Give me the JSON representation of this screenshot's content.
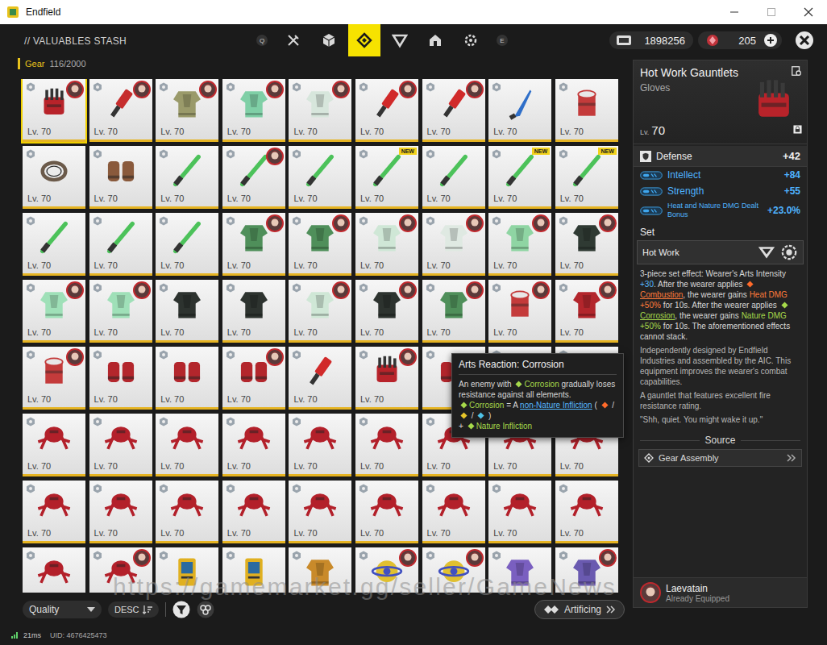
{
  "window": {
    "title": "Endfield"
  },
  "header": {
    "title": "// VALUABLES STASH",
    "key_prev": "Q",
    "key_next": "E",
    "tabs": [
      {
        "kind": "edit",
        "selected": false
      },
      {
        "kind": "cube",
        "selected": false
      },
      {
        "kind": "diamond",
        "selected": true
      },
      {
        "kind": "triangle",
        "selected": false
      },
      {
        "kind": "house",
        "selected": false
      },
      {
        "kind": "gear",
        "selected": false
      }
    ],
    "currencies": [
      {
        "kind": "coin",
        "value": "1898256",
        "plus": false
      },
      {
        "kind": "gem",
        "value": "205",
        "plus": true
      }
    ]
  },
  "category": {
    "label": "Gear",
    "count": "116/2000"
  },
  "cards": [
    {
      "kind": "gauntlet",
      "color": "#b8232a",
      "level": "Lv. 70",
      "equipped": true,
      "badge": "",
      "selected": true
    },
    {
      "kind": "tool",
      "color": "#c62d2d",
      "level": "Lv. 70",
      "equipped": true,
      "badge": "",
      "selected": false
    },
    {
      "kind": "armor",
      "color": "#9a9a6a",
      "level": "Lv. 70",
      "equipped": true,
      "badge": "",
      "selected": false
    },
    {
      "kind": "armor",
      "color": "#7fcfa6",
      "level": "Lv. 70",
      "equipped": true,
      "badge": "",
      "selected": false
    },
    {
      "kind": "armor",
      "color": "#d7e6dc",
      "level": "Lv. 70",
      "equipped": true,
      "badge": "",
      "selected": false
    },
    {
      "kind": "tool",
      "color": "#d12a2a",
      "level": "Lv. 70",
      "equipped": true,
      "badge": "",
      "selected": false
    },
    {
      "kind": "tool",
      "color": "#d12a2a",
      "level": "Lv. 70",
      "equipped": true,
      "badge": "",
      "selected": false
    },
    {
      "kind": "knife",
      "color": "#2f6fc9",
      "level": "Lv. 70",
      "equipped": false,
      "badge": "",
      "selected": false
    },
    {
      "kind": "drum",
      "color": "#c43b3b",
      "level": "Lv. 70",
      "equipped": false,
      "badge": "",
      "selected": false
    },
    {
      "kind": "ring",
      "color": "#6b5a4a",
      "level": "Lv. 70",
      "equipped": false,
      "badge": "",
      "selected": false
    },
    {
      "kind": "gloves",
      "color": "#8a5a3c",
      "level": "Lv. 70",
      "equipped": false,
      "badge": "",
      "selected": false
    },
    {
      "kind": "rod",
      "color": "#4cc25a",
      "level": "Lv. 70",
      "equipped": false,
      "badge": "",
      "selected": false
    },
    {
      "kind": "rod",
      "color": "#4cc25a",
      "level": "Lv. 70",
      "equipped": true,
      "badge": "",
      "selected": false
    },
    {
      "kind": "rod",
      "color": "#4cc25a",
      "level": "Lv. 70",
      "equipped": false,
      "badge": "",
      "selected": false
    },
    {
      "kind": "rod",
      "color": "#4cc25a",
      "level": "Lv. 70",
      "equipped": false,
      "badge": "NEW",
      "selected": false
    },
    {
      "kind": "rod",
      "color": "#4cc25a",
      "level": "Lv. 70",
      "equipped": false,
      "badge": "",
      "selected": false
    },
    {
      "kind": "rod",
      "color": "#4cc25a",
      "level": "Lv. 70",
      "equipped": false,
      "badge": "NEW",
      "selected": false
    },
    {
      "kind": "rod",
      "color": "#4cc25a",
      "level": "Lv. 70",
      "equipped": false,
      "badge": "NEW",
      "selected": false
    },
    {
      "kind": "rod",
      "color": "#4cc25a",
      "level": "Lv. 70",
      "equipped": false,
      "badge": "",
      "selected": false
    },
    {
      "kind": "rod",
      "color": "#4cc25a",
      "level": "Lv. 70",
      "equipped": false,
      "badge": "",
      "selected": false
    },
    {
      "kind": "rod",
      "color": "#4cc25a",
      "level": "Lv. 70",
      "equipped": false,
      "badge": "",
      "selected": false
    },
    {
      "kind": "armor",
      "color": "#4f8f5a",
      "level": "Lv. 70",
      "equipped": true,
      "badge": "",
      "selected": false
    },
    {
      "kind": "armor",
      "color": "#4f8f5a",
      "level": "Lv. 70",
      "equipped": true,
      "badge": "",
      "selected": false
    },
    {
      "kind": "armor",
      "color": "#cfe7d6",
      "level": "Lv. 70",
      "equipped": true,
      "badge": "",
      "selected": false
    },
    {
      "kind": "armor",
      "color": "#dfe9e2",
      "level": "Lv. 70",
      "equipped": true,
      "badge": "",
      "selected": false
    },
    {
      "kind": "armor",
      "color": "#8fd5a3",
      "level": "Lv. 70",
      "equipped": true,
      "badge": "",
      "selected": false
    },
    {
      "kind": "armor",
      "color": "#2f3a33",
      "level": "Lv. 70",
      "equipped": true,
      "badge": "",
      "selected": false
    },
    {
      "kind": "armor",
      "color": "#9fe0b8",
      "level": "Lv. 70",
      "equipped": true,
      "badge": "",
      "selected": false
    },
    {
      "kind": "armor",
      "color": "#9fe0b8",
      "level": "Lv. 70",
      "equipped": true,
      "badge": "",
      "selected": false
    },
    {
      "kind": "armor",
      "color": "#2d332f",
      "level": "Lv. 70",
      "equipped": false,
      "badge": "",
      "selected": false
    },
    {
      "kind": "armor",
      "color": "#2d332f",
      "level": "Lv. 70",
      "equipped": false,
      "badge": "",
      "selected": false
    },
    {
      "kind": "armor",
      "color": "#cfe7d6",
      "level": "Lv. 70",
      "equipped": true,
      "badge": "",
      "selected": false
    },
    {
      "kind": "armor",
      "color": "#2d332f",
      "level": "Lv. 70",
      "equipped": true,
      "badge": "",
      "selected": false
    },
    {
      "kind": "armor",
      "color": "#4f8f5a",
      "level": "Lv. 70",
      "equipped": true,
      "badge": "",
      "selected": false
    },
    {
      "kind": "drum",
      "color": "#c43b3b",
      "level": "Lv. 70",
      "equipped": true,
      "badge": "",
      "selected": false
    },
    {
      "kind": "armor",
      "color": "#b3262c",
      "level": "Lv. 70",
      "equipped": true,
      "badge": "",
      "selected": false
    },
    {
      "kind": "drum",
      "color": "#c43b3b",
      "level": "Lv. 70",
      "equipped": true,
      "badge": "",
      "selected": false
    },
    {
      "kind": "gloves",
      "color": "#b3262c",
      "level": "Lv. 70",
      "equipped": false,
      "badge": "",
      "selected": false
    },
    {
      "kind": "gloves",
      "color": "#b3262c",
      "level": "Lv. 70",
      "equipped": false,
      "badge": "",
      "selected": false
    },
    {
      "kind": "gloves",
      "color": "#b3262c",
      "level": "Lv. 70",
      "equipped": true,
      "badge": "",
      "selected": false
    },
    {
      "kind": "tool",
      "color": "#d12a2a",
      "level": "Lv. 70",
      "equipped": false,
      "badge": "",
      "selected": false
    },
    {
      "kind": "gauntlet",
      "color": "#b8232a",
      "level": "Lv. 70",
      "equipped": true,
      "badge": "",
      "selected": false
    },
    {
      "kind": "gloves",
      "color": "#b3262c",
      "level": "",
      "equipped": false,
      "badge": "",
      "selected": false
    },
    {
      "kind": "gloves",
      "color": "#b3262c",
      "level": "",
      "equipped": false,
      "badge": "",
      "selected": false
    },
    {
      "kind": "gloves",
      "color": "#b3262c",
      "level": "",
      "equipped": false,
      "badge": "",
      "selected": false
    },
    {
      "kind": "spider",
      "color": "#b3202a",
      "level": "Lv. 70",
      "equipped": false,
      "badge": "",
      "selected": false
    },
    {
      "kind": "spider",
      "color": "#b3202a",
      "level": "Lv. 70",
      "equipped": false,
      "badge": "",
      "selected": false
    },
    {
      "kind": "spider",
      "color": "#b3202a",
      "level": "Lv. 70",
      "equipped": false,
      "badge": "",
      "selected": false
    },
    {
      "kind": "spider",
      "color": "#b3202a",
      "level": "Lv. 70",
      "equipped": false,
      "badge": "",
      "selected": false
    },
    {
      "kind": "spider",
      "color": "#b3202a",
      "level": "Lv. 70",
      "equipped": false,
      "badge": "",
      "selected": false
    },
    {
      "kind": "spider",
      "color": "#b3202a",
      "level": "Lv. 70",
      "equipped": false,
      "badge": "",
      "selected": false
    },
    {
      "kind": "spider",
      "color": "#b3202a",
      "level": "Lv. 70",
      "equipped": false,
      "badge": "",
      "selected": false
    },
    {
      "kind": "spider",
      "color": "#b3202a",
      "level": "Lv. 70",
      "equipped": false,
      "badge": "",
      "selected": false
    },
    {
      "kind": "spider",
      "color": "#b3202a",
      "level": "Lv. 70",
      "equipped": false,
      "badge": "",
      "selected": false
    },
    {
      "kind": "spider",
      "color": "#b3202a",
      "level": "Lv. 70",
      "equipped": false,
      "badge": "",
      "selected": false
    },
    {
      "kind": "spider",
      "color": "#b3202a",
      "level": "Lv. 70",
      "equipped": false,
      "badge": "",
      "selected": false
    },
    {
      "kind": "spider",
      "color": "#b3202a",
      "level": "Lv. 70",
      "equipped": false,
      "badge": "",
      "selected": false
    },
    {
      "kind": "spider",
      "color": "#b3202a",
      "level": "Lv. 70",
      "equipped": false,
      "badge": "",
      "selected": false
    },
    {
      "kind": "spider",
      "color": "#b3202a",
      "level": "Lv. 70",
      "equipped": false,
      "badge": "",
      "selected": false
    },
    {
      "kind": "spider",
      "color": "#b3202a",
      "level": "Lv. 70",
      "equipped": false,
      "badge": "",
      "selected": false
    },
    {
      "kind": "spider",
      "color": "#b3202a",
      "level": "Lv. 70",
      "equipped": false,
      "badge": "",
      "selected": false
    },
    {
      "kind": "spider",
      "color": "#b3202a",
      "level": "Lv. 70",
      "equipped": false,
      "badge": "",
      "selected": false
    },
    {
      "kind": "spider",
      "color": "#b3202a",
      "level": "Lv. 70",
      "equipped": false,
      "badge": "",
      "selected": false
    },
    {
      "kind": "spider",
      "color": "#b3202a",
      "level": "",
      "equipped": false,
      "badge": "",
      "selected": false
    },
    {
      "kind": "spider",
      "color": "#b3202a",
      "level": "",
      "equipped": true,
      "badge": "",
      "selected": false
    },
    {
      "kind": "device",
      "color": "#e0b020",
      "level": "",
      "equipped": false,
      "badge": "",
      "selected": false
    },
    {
      "kind": "device",
      "color": "#e0b020",
      "level": "",
      "equipped": false,
      "badge": "",
      "selected": false
    },
    {
      "kind": "armor",
      "color": "#c98a2a",
      "level": "",
      "equipped": false,
      "badge": "",
      "selected": false
    },
    {
      "kind": "orb",
      "color": "#e0c030",
      "level": "",
      "equipped": true,
      "badge": "",
      "selected": false
    },
    {
      "kind": "orb",
      "color": "#e0c030",
      "level": "",
      "equipped": true,
      "badge": "",
      "selected": false
    },
    {
      "kind": "armor",
      "color": "#7a5fc0",
      "level": "",
      "equipped": false,
      "badge": "",
      "selected": false
    },
    {
      "kind": "armor",
      "color": "#6a5ab0",
      "level": "",
      "equipped": true,
      "badge": "",
      "selected": false
    }
  ],
  "tooltip": {
    "title": "Arts Reaction: Corrosion",
    "lines": [
      [
        {
          "kind": "text",
          "text": "An enemy with ",
          "tone": "plain",
          "underline": false
        },
        {
          "kind": "icon",
          "color": "#a6d94a"
        },
        {
          "kind": "text",
          "text": "Corrosion",
          "tone": "nature",
          "underline": false
        },
        {
          "kind": "text",
          "text": " gradually loses resistance against all elements.",
          "tone": "plain",
          "underline": false
        }
      ],
      [
        {
          "kind": "icon",
          "color": "#a6d94a"
        },
        {
          "kind": "text",
          "text": "Corrosion",
          "tone": "nature",
          "underline": false
        },
        {
          "kind": "text",
          "text": " = A ",
          "tone": "plain",
          "underline": false
        },
        {
          "kind": "text",
          "text": "non-Nature Infliction",
          "tone": "link",
          "underline": true
        },
        {
          "kind": "text",
          "text": " ( ",
          "tone": "plain",
          "underline": false
        },
        {
          "kind": "icon",
          "color": "#ff6a2a"
        },
        {
          "kind": "text",
          "text": " / ",
          "tone": "plain",
          "underline": false
        },
        {
          "kind": "icon",
          "color": "#e8c62a"
        },
        {
          "kind": "text",
          "text": " / ",
          "tone": "plain",
          "underline": false
        },
        {
          "kind": "icon",
          "color": "#4fc3e8"
        },
        {
          "kind": "text",
          "text": " )",
          "tone": "plain",
          "underline": false
        }
      ],
      [
        {
          "kind": "text",
          "text": "+ ",
          "tone": "plain",
          "underline": false
        },
        {
          "kind": "icon",
          "color": "#a6d94a"
        },
        {
          "kind": "text",
          "text": "Nature Infliction",
          "tone": "nature",
          "underline": false
        }
      ]
    ]
  },
  "detail": {
    "name": "Hot Work Gauntlets",
    "type": "Gloves",
    "level_prefix": "Lv.",
    "level": "70",
    "stats": [
      {
        "kind": "main",
        "label": "Defense",
        "value": "+42"
      },
      {
        "kind": "attr",
        "label": "Intellect",
        "value": "+84"
      },
      {
        "kind": "attr",
        "label": "Strength",
        "value": "+55"
      },
      {
        "kind": "bonus",
        "label": "Heat and Nature DMG Dealt Bonus",
        "value": "+23.0%"
      }
    ],
    "set_label": "Set",
    "set_name": "Hot Work",
    "set_effect": [
      {
        "kind": "text",
        "text": "3-piece set effect: Wearer's Arts Intensity ",
        "tone": "plain",
        "underline": false
      },
      {
        "kind": "text",
        "text": "+30",
        "tone": "link",
        "underline": false
      },
      {
        "kind": "text",
        "text": ". After the wearer applies ",
        "tone": "plain",
        "underline": false
      },
      {
        "kind": "icon",
        "color": "#ff6a2a"
      },
      {
        "kind": "text",
        "text": "Combustion",
        "tone": "heat",
        "underline": true
      },
      {
        "kind": "text",
        "text": ", the wearer gains ",
        "tone": "plain",
        "underline": false
      },
      {
        "kind": "text",
        "text": "Heat DMG +50%",
        "tone": "heat",
        "underline": false
      },
      {
        "kind": "text",
        "text": " for 10s. After the wearer applies ",
        "tone": "plain",
        "underline": false
      },
      {
        "kind": "icon",
        "color": "#a6d94a"
      },
      {
        "kind": "text",
        "text": "Corrosion",
        "tone": "nature",
        "underline": true
      },
      {
        "kind": "text",
        "text": ", the wearer gains ",
        "tone": "plain",
        "underline": false
      },
      {
        "kind": "text",
        "text": "Nature DMG +50%",
        "tone": "nature",
        "underline": false
      },
      {
        "kind": "text",
        "text": " for 10s. The aforementioned effects cannot stack.",
        "tone": "plain",
        "underline": false
      }
    ],
    "description": [
      "Independently designed by Endfield Industries and assembled by the AIC. This equipment improves the wearer's combat capabilities.",
      "A gauntlet that features excellent fire resistance rating.",
      "\"Shh, quiet. You might wake it up.\""
    ],
    "source_label": "Source",
    "source": "Gear Assembly",
    "equipped_by": {
      "name": "Laevatain",
      "status": "Already Equipped"
    }
  },
  "toolbar": {
    "sort": "Quality",
    "order": "DESC",
    "action": "Artificing"
  },
  "footer": {
    "ping": "21ms",
    "uid": "UID: 4676425473"
  },
  "watermark": "https://gamemarket.gg/seller/GameNews"
}
